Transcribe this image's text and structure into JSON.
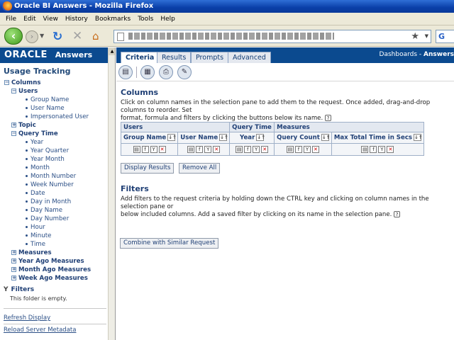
{
  "window": {
    "title": "Oracle BI Answers - Mozilla Firefox"
  },
  "menu": [
    "File",
    "Edit",
    "View",
    "History",
    "Bookmarks",
    "Tools",
    "Help"
  ],
  "search": {
    "label": "G"
  },
  "left": {
    "brand_oracle": "ORACLE",
    "brand_answers": "Answers",
    "subject_area": "Usage Tracking",
    "tree": [
      {
        "label": "Columns",
        "level": 0,
        "toggle": "−",
        "bold": true
      },
      {
        "label": "Users",
        "level": 1,
        "toggle": "−",
        "bold": true
      },
      {
        "label": "Group Name",
        "level": 2,
        "leaf": true
      },
      {
        "label": "User Name",
        "level": 2,
        "leaf": true
      },
      {
        "label": "Impersonated User",
        "level": 2,
        "leaf": true
      },
      {
        "label": "Topic",
        "level": 1,
        "toggle": "+",
        "bold": true
      },
      {
        "label": "Query Time",
        "level": 1,
        "toggle": "−",
        "bold": true
      },
      {
        "label": "Year",
        "level": 2,
        "leaf": true
      },
      {
        "label": "Year Quarter",
        "level": 2,
        "leaf": true
      },
      {
        "label": "Year Month",
        "level": 2,
        "leaf": true
      },
      {
        "label": "Month",
        "level": 2,
        "leaf": true
      },
      {
        "label": "Month Number",
        "level": 2,
        "leaf": true
      },
      {
        "label": "Week Number",
        "level": 2,
        "leaf": true
      },
      {
        "label": "Date",
        "level": 2,
        "leaf": true
      },
      {
        "label": "Day in Month",
        "level": 2,
        "leaf": true
      },
      {
        "label": "Day Name",
        "level": 2,
        "leaf": true
      },
      {
        "label": "Day Number",
        "level": 2,
        "leaf": true
      },
      {
        "label": "Hour",
        "level": 2,
        "leaf": true
      },
      {
        "label": "Minute",
        "level": 2,
        "leaf": true
      },
      {
        "label": "Time",
        "level": 2,
        "leaf": true
      },
      {
        "label": "Measures",
        "level": 1,
        "toggle": "+",
        "bold": true
      },
      {
        "label": "Year Ago Measures",
        "level": 1,
        "toggle": "+",
        "bold": true
      },
      {
        "label": "Month Ago Measures",
        "level": 1,
        "toggle": "+",
        "bold": true
      },
      {
        "label": "Week Ago Measures",
        "level": 1,
        "toggle": "+",
        "bold": true
      }
    ],
    "filters_title": "Filters",
    "filters_empty": "This folder is empty.",
    "refresh_display": "Refresh Display",
    "reload_metadata": "Reload Server Metadata"
  },
  "tabs": [
    "Criteria",
    "Results",
    "Prompts",
    "Advanced"
  ],
  "active_tab": "Criteria",
  "dashboards": {
    "label": "Dashboards - ",
    "bold": "Answers"
  },
  "columns": {
    "title": "Columns",
    "description_1": "Click on column names in the selection pane to add them to the request. Once added, drag-and-drop columns to reorder. Set",
    "description_2": "format, formula and filters by clicking the buttons below its name.",
    "groups": [
      {
        "name": "Users",
        "span": 2
      },
      {
        "name": "Query Time",
        "span": 1
      },
      {
        "name": "Measures",
        "span": 2
      }
    ],
    "headers": [
      "Group Name",
      "User Name",
      "Year",
      "Query Count",
      "Max Total Time in Secs"
    ]
  },
  "buttons": {
    "display_results": "Display Results",
    "remove_all": "Remove All",
    "combine": "Combine with Similar Request"
  },
  "filters": {
    "title": "Filters",
    "description_1": "Add filters to the request criteria by holding down the CTRL key and clicking on column names in the selection pane or",
    "description_2": "below included columns. Add a saved filter by clicking on its name in the selection pane."
  }
}
